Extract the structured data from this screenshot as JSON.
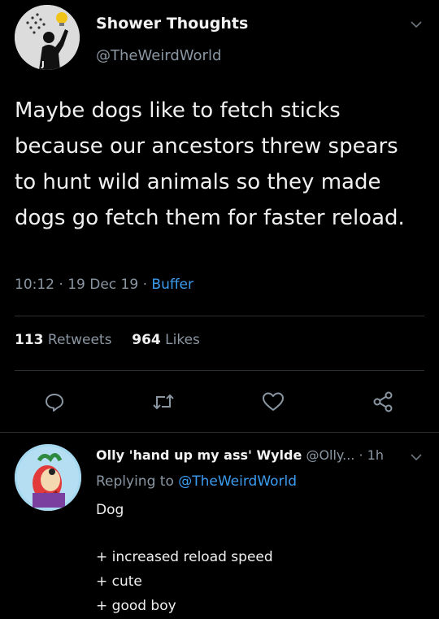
{
  "tweet": {
    "display_name": "Shower Thoughts",
    "handle": "@TheWeirdWorld",
    "text": "Maybe dogs like to fetch sticks because our ancestors threw spears to hunt wild animals so they made dogs go fetch them for faster reload.",
    "time": "10:12",
    "date": "19 Dec 19",
    "source": "Buffer",
    "retweets_count": "113",
    "retweets_label": "Retweets",
    "likes_count": "964",
    "likes_label": "Likes",
    "icons": [
      "reply-icon",
      "retweet-icon",
      "like-icon",
      "share-icon",
      "chevron-down-icon"
    ]
  },
  "reply": {
    "display_name": "Olly 'hand up my ass' Wylde",
    "handle": "@Olly...",
    "age": "1h",
    "replying_prefix": "Replying to",
    "replying_handle": "@TheWeirdWorld",
    "line1": "Dog",
    "line2": "+ increased reload speed",
    "line3": "+ cute",
    "line4": "+ good boy"
  },
  "colors": {
    "background": "#000000",
    "text": "#e8e8e8",
    "muted": "#8a96a2",
    "link": "#3b9cf0",
    "divider": "#2a2f33"
  }
}
